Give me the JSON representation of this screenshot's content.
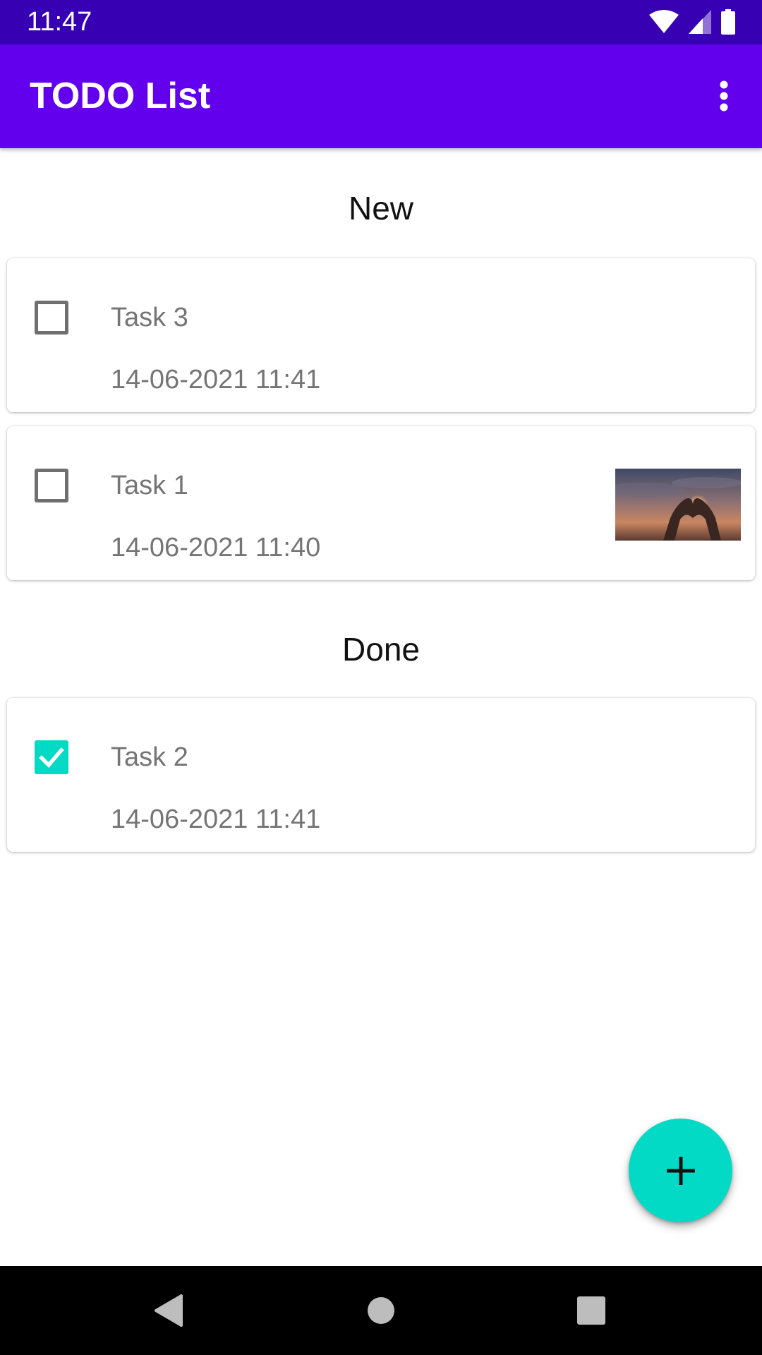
{
  "status_bar": {
    "time": "11:47",
    "icons": [
      "wifi-icon",
      "cell-signal-icon",
      "battery-icon"
    ]
  },
  "app_bar": {
    "title": "TODO List",
    "overflow_icon": "more-vert-icon"
  },
  "sections": [
    {
      "header": "New",
      "tasks": [
        {
          "title": "Task 3",
          "date": "14-06-2021 11:41",
          "checked": false,
          "has_image": false
        },
        {
          "title": "Task 1",
          "date": "14-06-2021 11:40",
          "checked": false,
          "has_image": true
        }
      ]
    },
    {
      "header": "Done",
      "tasks": [
        {
          "title": "Task 2",
          "date": "14-06-2021 11:41",
          "checked": true,
          "has_image": false
        }
      ]
    }
  ],
  "fab": {
    "icon": "plus-icon"
  },
  "nav_bar": {
    "icons": [
      "back-icon",
      "home-icon",
      "recents-icon"
    ]
  },
  "colors": {
    "status_bar": "#3700b3",
    "app_bar": "#6200ee",
    "accent": "#03dac5",
    "secondary_text": "#757575"
  }
}
